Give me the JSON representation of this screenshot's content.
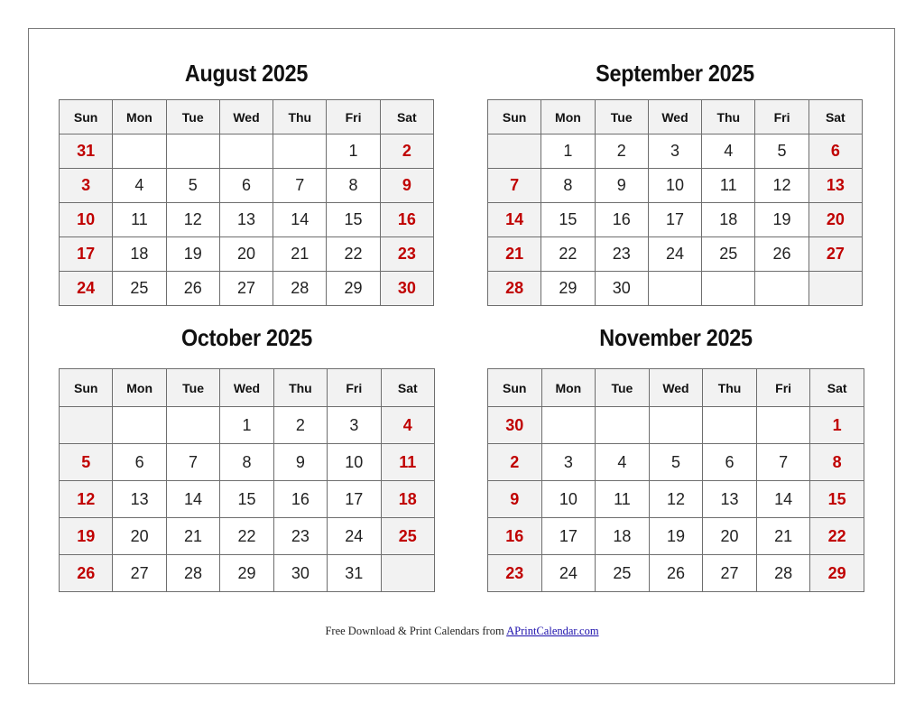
{
  "weekdays": [
    "Sun",
    "Mon",
    "Tue",
    "Wed",
    "Thu",
    "Fri",
    "Sat"
  ],
  "colors": {
    "weekend_text": "#c00000",
    "weekend_bg": "#f2f2f2",
    "header_bg": "#f2f2f2",
    "grid": "#6e6e6e",
    "link": "#1a0dab"
  },
  "months": [
    {
      "title": "August 2025",
      "weeks": [
        [
          "31",
          "",
          "",
          "",
          "",
          "1",
          "2"
        ],
        [
          "3",
          "4",
          "5",
          "6",
          "7",
          "8",
          "9"
        ],
        [
          "10",
          "11",
          "12",
          "13",
          "14",
          "15",
          "16"
        ],
        [
          "17",
          "18",
          "19",
          "20",
          "21",
          "22",
          "23"
        ],
        [
          "24",
          "25",
          "26",
          "27",
          "28",
          "29",
          "30"
        ]
      ]
    },
    {
      "title": "September 2025",
      "weeks": [
        [
          "",
          "1",
          "2",
          "3",
          "4",
          "5",
          "6"
        ],
        [
          "7",
          "8",
          "9",
          "10",
          "11",
          "12",
          "13"
        ],
        [
          "14",
          "15",
          "16",
          "17",
          "18",
          "19",
          "20"
        ],
        [
          "21",
          "22",
          "23",
          "24",
          "25",
          "26",
          "27"
        ],
        [
          "28",
          "29",
          "30",
          "",
          "",
          "",
          ""
        ]
      ]
    },
    {
      "title": "October 2025",
      "weeks": [
        [
          "",
          "",
          "",
          "1",
          "2",
          "3",
          "4"
        ],
        [
          "5",
          "6",
          "7",
          "8",
          "9",
          "10",
          "11"
        ],
        [
          "12",
          "13",
          "14",
          "15",
          "16",
          "17",
          "18"
        ],
        [
          "19",
          "20",
          "21",
          "22",
          "23",
          "24",
          "25"
        ],
        [
          "26",
          "27",
          "28",
          "29",
          "30",
          "31",
          ""
        ]
      ]
    },
    {
      "title": "November 2025",
      "weeks": [
        [
          "30",
          "",
          "",
          "",
          "",
          "",
          "1"
        ],
        [
          "2",
          "3",
          "4",
          "5",
          "6",
          "7",
          "8"
        ],
        [
          "9",
          "10",
          "11",
          "12",
          "13",
          "14",
          "15"
        ],
        [
          "16",
          "17",
          "18",
          "19",
          "20",
          "21",
          "22"
        ],
        [
          "23",
          "24",
          "25",
          "26",
          "27",
          "28",
          "29"
        ]
      ]
    }
  ],
  "footer": {
    "text": "Free Download & Print Calendars from ",
    "link_text": "APrintCalendar.com"
  }
}
